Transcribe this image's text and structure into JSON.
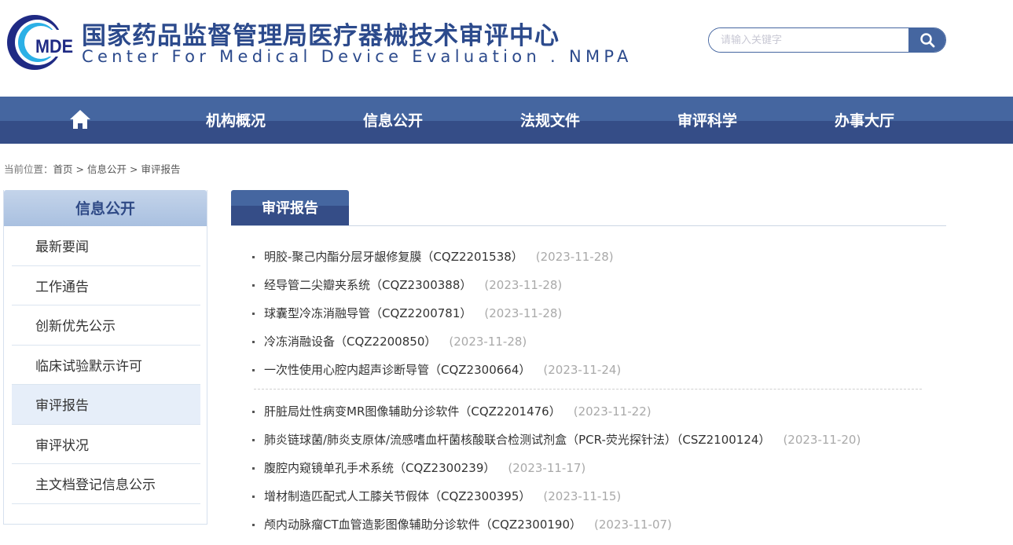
{
  "header": {
    "title_cn": "国家药品监督管理局医疗器械技术审评中心",
    "title_en": "Center For Medical Device Evaluation . NMPA",
    "logo_text": "MDE",
    "search_placeholder": "请输入关键字"
  },
  "nav": {
    "items": [
      "机构概况",
      "信息公开",
      "法规文件",
      "审评科学",
      "办事大厅"
    ]
  },
  "breadcrumb": {
    "label": "当前位置：",
    "items": [
      "首页",
      "信息公开",
      "审评报告"
    ],
    "sep": ">"
  },
  "sidebar": {
    "title": "信息公开",
    "items": [
      "最新要闻",
      "工作通告",
      "创新优先公示",
      "临床试验默示许可",
      "审评报告",
      "审评状况",
      "主文档登记信息公示"
    ]
  },
  "main": {
    "tab": "审评报告",
    "group1": [
      {
        "title": "明胶-聚己内酯分层牙龈修复膜（CQZ2201538）",
        "date": "(2023-11-28)"
      },
      {
        "title": "经导管二尖瓣夹系统（CQZ2300388）",
        "date": "(2023-11-28)"
      },
      {
        "title": "球囊型冷冻消融导管（CQZ2200781）",
        "date": "(2023-11-28)"
      },
      {
        "title": "冷冻消融设备（CQZ2200850）",
        "date": "(2023-11-28)"
      },
      {
        "title": "一次性使用心腔内超声诊断导管（CQZ2300664）",
        "date": "(2023-11-24)"
      }
    ],
    "group2": [
      {
        "title": "肝脏局灶性病变MR图像辅助分诊软件（CQZ2201476）",
        "date": "(2023-11-22)"
      },
      {
        "title": "肺炎链球菌/肺炎支原体/流感嗜血杆菌核酸联合检测试剂盒（PCR-荧光探针法）（CSZ2100124）",
        "date": "(2023-11-20)"
      },
      {
        "title": "腹腔内窥镜单孔手术系统（CQZ2300239）",
        "date": "(2023-11-17)"
      },
      {
        "title": "增材制造匹配式人工膝关节假体（CQZ2300395）",
        "date": "(2023-11-15)"
      },
      {
        "title": "颅内动脉瘤CT血管造影图像辅助分诊软件（CQZ2300190）",
        "date": "(2023-11-07)"
      }
    ]
  }
}
